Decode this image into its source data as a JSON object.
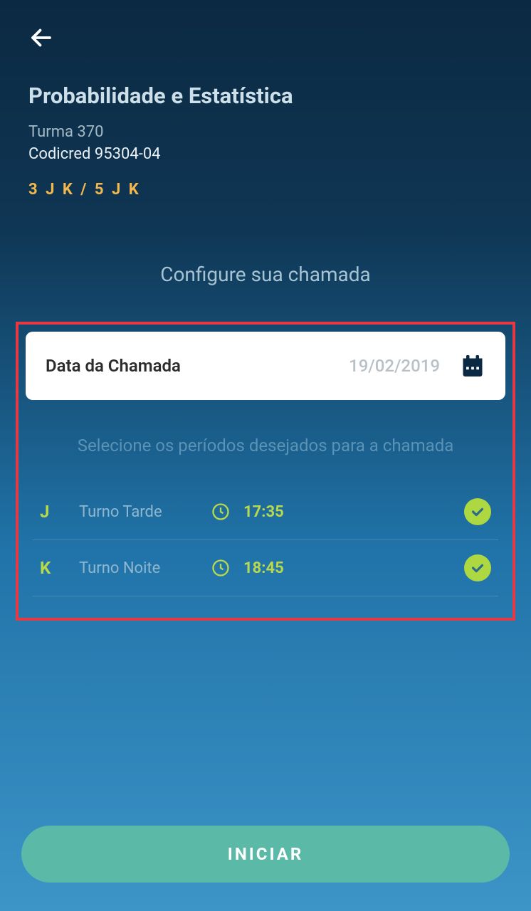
{
  "header": {
    "title": "Probabilidade e Estatística",
    "turma": "Turma 370",
    "codicred": "Codicred 95304-04",
    "schedule_code": "3 J K / 5 J K"
  },
  "config": {
    "title": "Configure sua chamada",
    "date_label": "Data da Chamada",
    "date_value": "19/02/2019",
    "select_periods_title": "Selecione os períodos desejados para a chamada",
    "periods": [
      {
        "code": "J",
        "shift": "Turno Tarde",
        "time": "17:35"
      },
      {
        "code": "K",
        "shift": "Turno Noite",
        "time": "18:45"
      }
    ]
  },
  "actions": {
    "start": "INICIAR"
  }
}
